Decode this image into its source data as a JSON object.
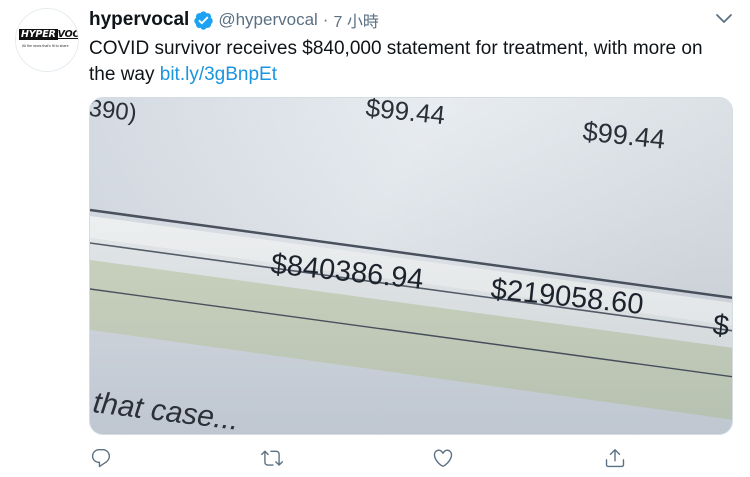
{
  "account": {
    "display_name": "hypervocal",
    "handle": "@hypervocal",
    "separator": "·",
    "time": "7 小時",
    "avatar_logo_box": "HYPER",
    "avatar_logo_tail": "VOCAL",
    "avatar_tagline": "All the news that's fit to share"
  },
  "tweet": {
    "text": "COVID survivor receives $840,000 statement for treatment, with more on the way ",
    "link": "bit.ly/3gBnpEt"
  },
  "media": {
    "top_left": "390)",
    "top_mid": "$99.44",
    "top_right": "$99.44",
    "amount_main": "$840386.94",
    "amount_second": "$219058.60",
    "amount_edge": "$",
    "bottom_text": "that case..."
  },
  "icons": {
    "verified": "verified-badge-icon",
    "caret": "chevron-down-icon",
    "reply": "reply-icon",
    "retweet": "retweet-icon",
    "like": "heart-icon",
    "share": "share-icon"
  },
  "colors": {
    "link": "#1b95e0",
    "verified": "#1da1f2",
    "secondary_text": "#5b7083",
    "action_icon": "#5b7083"
  }
}
